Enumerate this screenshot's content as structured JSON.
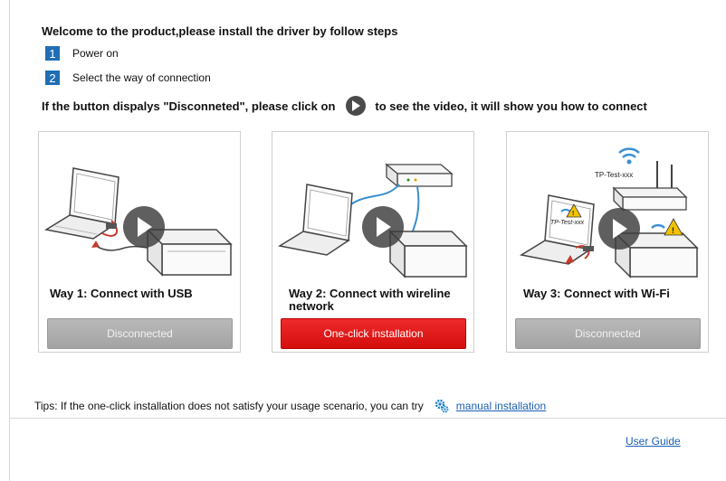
{
  "header": {
    "title": "Welcome to the product,please install the driver by follow steps",
    "steps": [
      {
        "num": "1",
        "label": "Power on"
      },
      {
        "num": "2",
        "label": "Select the way of connection"
      }
    ],
    "hint_before": "If the button dispalys \"Disconneted\", please click on",
    "hint_after": "to see the video, it will show you how to connect"
  },
  "cards": [
    {
      "title": "Way 1: Connect with USB",
      "button": "Disconnected",
      "state": "disconnected"
    },
    {
      "title": "Way 2: Connect with wireline network",
      "button": "One-click installation",
      "state": "install"
    },
    {
      "title": "Way 3: Connect with Wi-Fi",
      "button": "Disconnected",
      "state": "disconnected",
      "ssid_labels": [
        "TP-Test-xxx",
        "TP-Test-xxx"
      ]
    }
  ],
  "footer": {
    "tips_text": "Tips: If the one-click installation does not satisfy your usage scenario, you can try",
    "manual_link": "manual installation",
    "user_guide": "User Guide"
  },
  "colors": {
    "step_badge": "#1f6fb5",
    "install_button": "#e01818",
    "link": "#1a5fb4"
  }
}
